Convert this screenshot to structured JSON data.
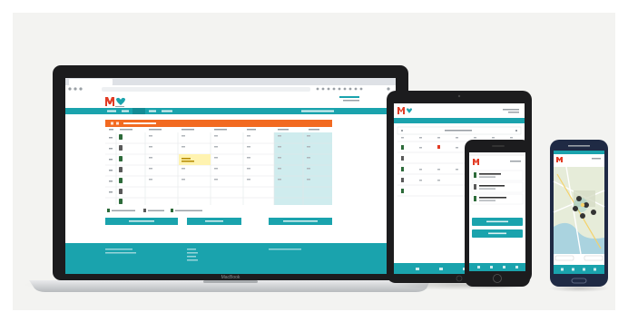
{
  "laptop": {
    "brand_label": "MacBook"
  },
  "colors": {
    "teal": "#1aa3ad",
    "teal_dark": "#138b95",
    "orange": "#f26a21",
    "logo_red": "#e23b24",
    "light_teal": "#cfecee",
    "yellow": "#fff3b0",
    "device_black": "#1c1c1e",
    "silver": "#c9cccf"
  },
  "icons": [
    "logo-icon",
    "calendar-icon",
    "phone-icon",
    "map-pin-icon",
    "home-button-icon"
  ]
}
